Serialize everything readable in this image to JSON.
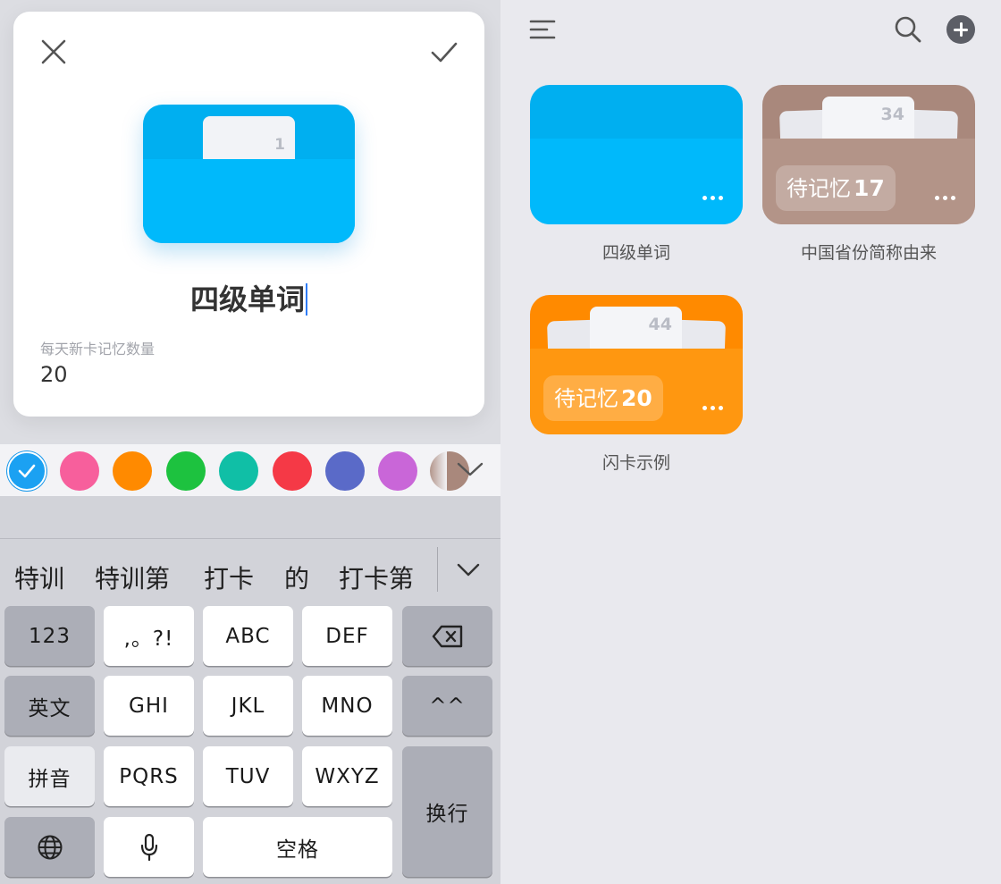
{
  "editor": {
    "deck_name": "四级单词",
    "deck_card_count": "1",
    "daily_label": "每天新卡记忆数量",
    "daily_value": "20"
  },
  "colors": {
    "swatches": [
      "#00aff0",
      "#f75f9c",
      "#ff8a00",
      "#1dc23f",
      "#10bfa6",
      "#f53946",
      "#5a6ac8",
      "#c966d8",
      "#a9887c"
    ],
    "selected_index": 0
  },
  "keyboard": {
    "candidates": [
      "特训",
      "特训第",
      "打卡",
      "的",
      "打卡第"
    ],
    "keys": {
      "num": "123",
      "punct": ",。?!",
      "abc": "ABC",
      "def": "DEF",
      "english": "英文",
      "ghi": "GHI",
      "jkl": "JKL",
      "mno": "MNO",
      "emoji": "^^",
      "pinyin": "拼音",
      "pqrs": "PQRS",
      "tuv": "TUV",
      "wxyz": "WXYZ",
      "return": "换行",
      "space": "空格"
    }
  },
  "decks": [
    {
      "name": "四级单词",
      "color": "#00aff0",
      "pocket_color": "#00b9fb"
    },
    {
      "name": "中国省份简称由来",
      "color": "#a9887c",
      "pocket_color": "#b39488",
      "card_count": "34",
      "badge_label": "待记忆",
      "badge_count": "17"
    },
    {
      "name": "闪卡示例",
      "color": "#ff8a00",
      "pocket_color": "#ff9710",
      "card_count": "44",
      "badge_label": "待记忆",
      "badge_count": "20"
    }
  ]
}
